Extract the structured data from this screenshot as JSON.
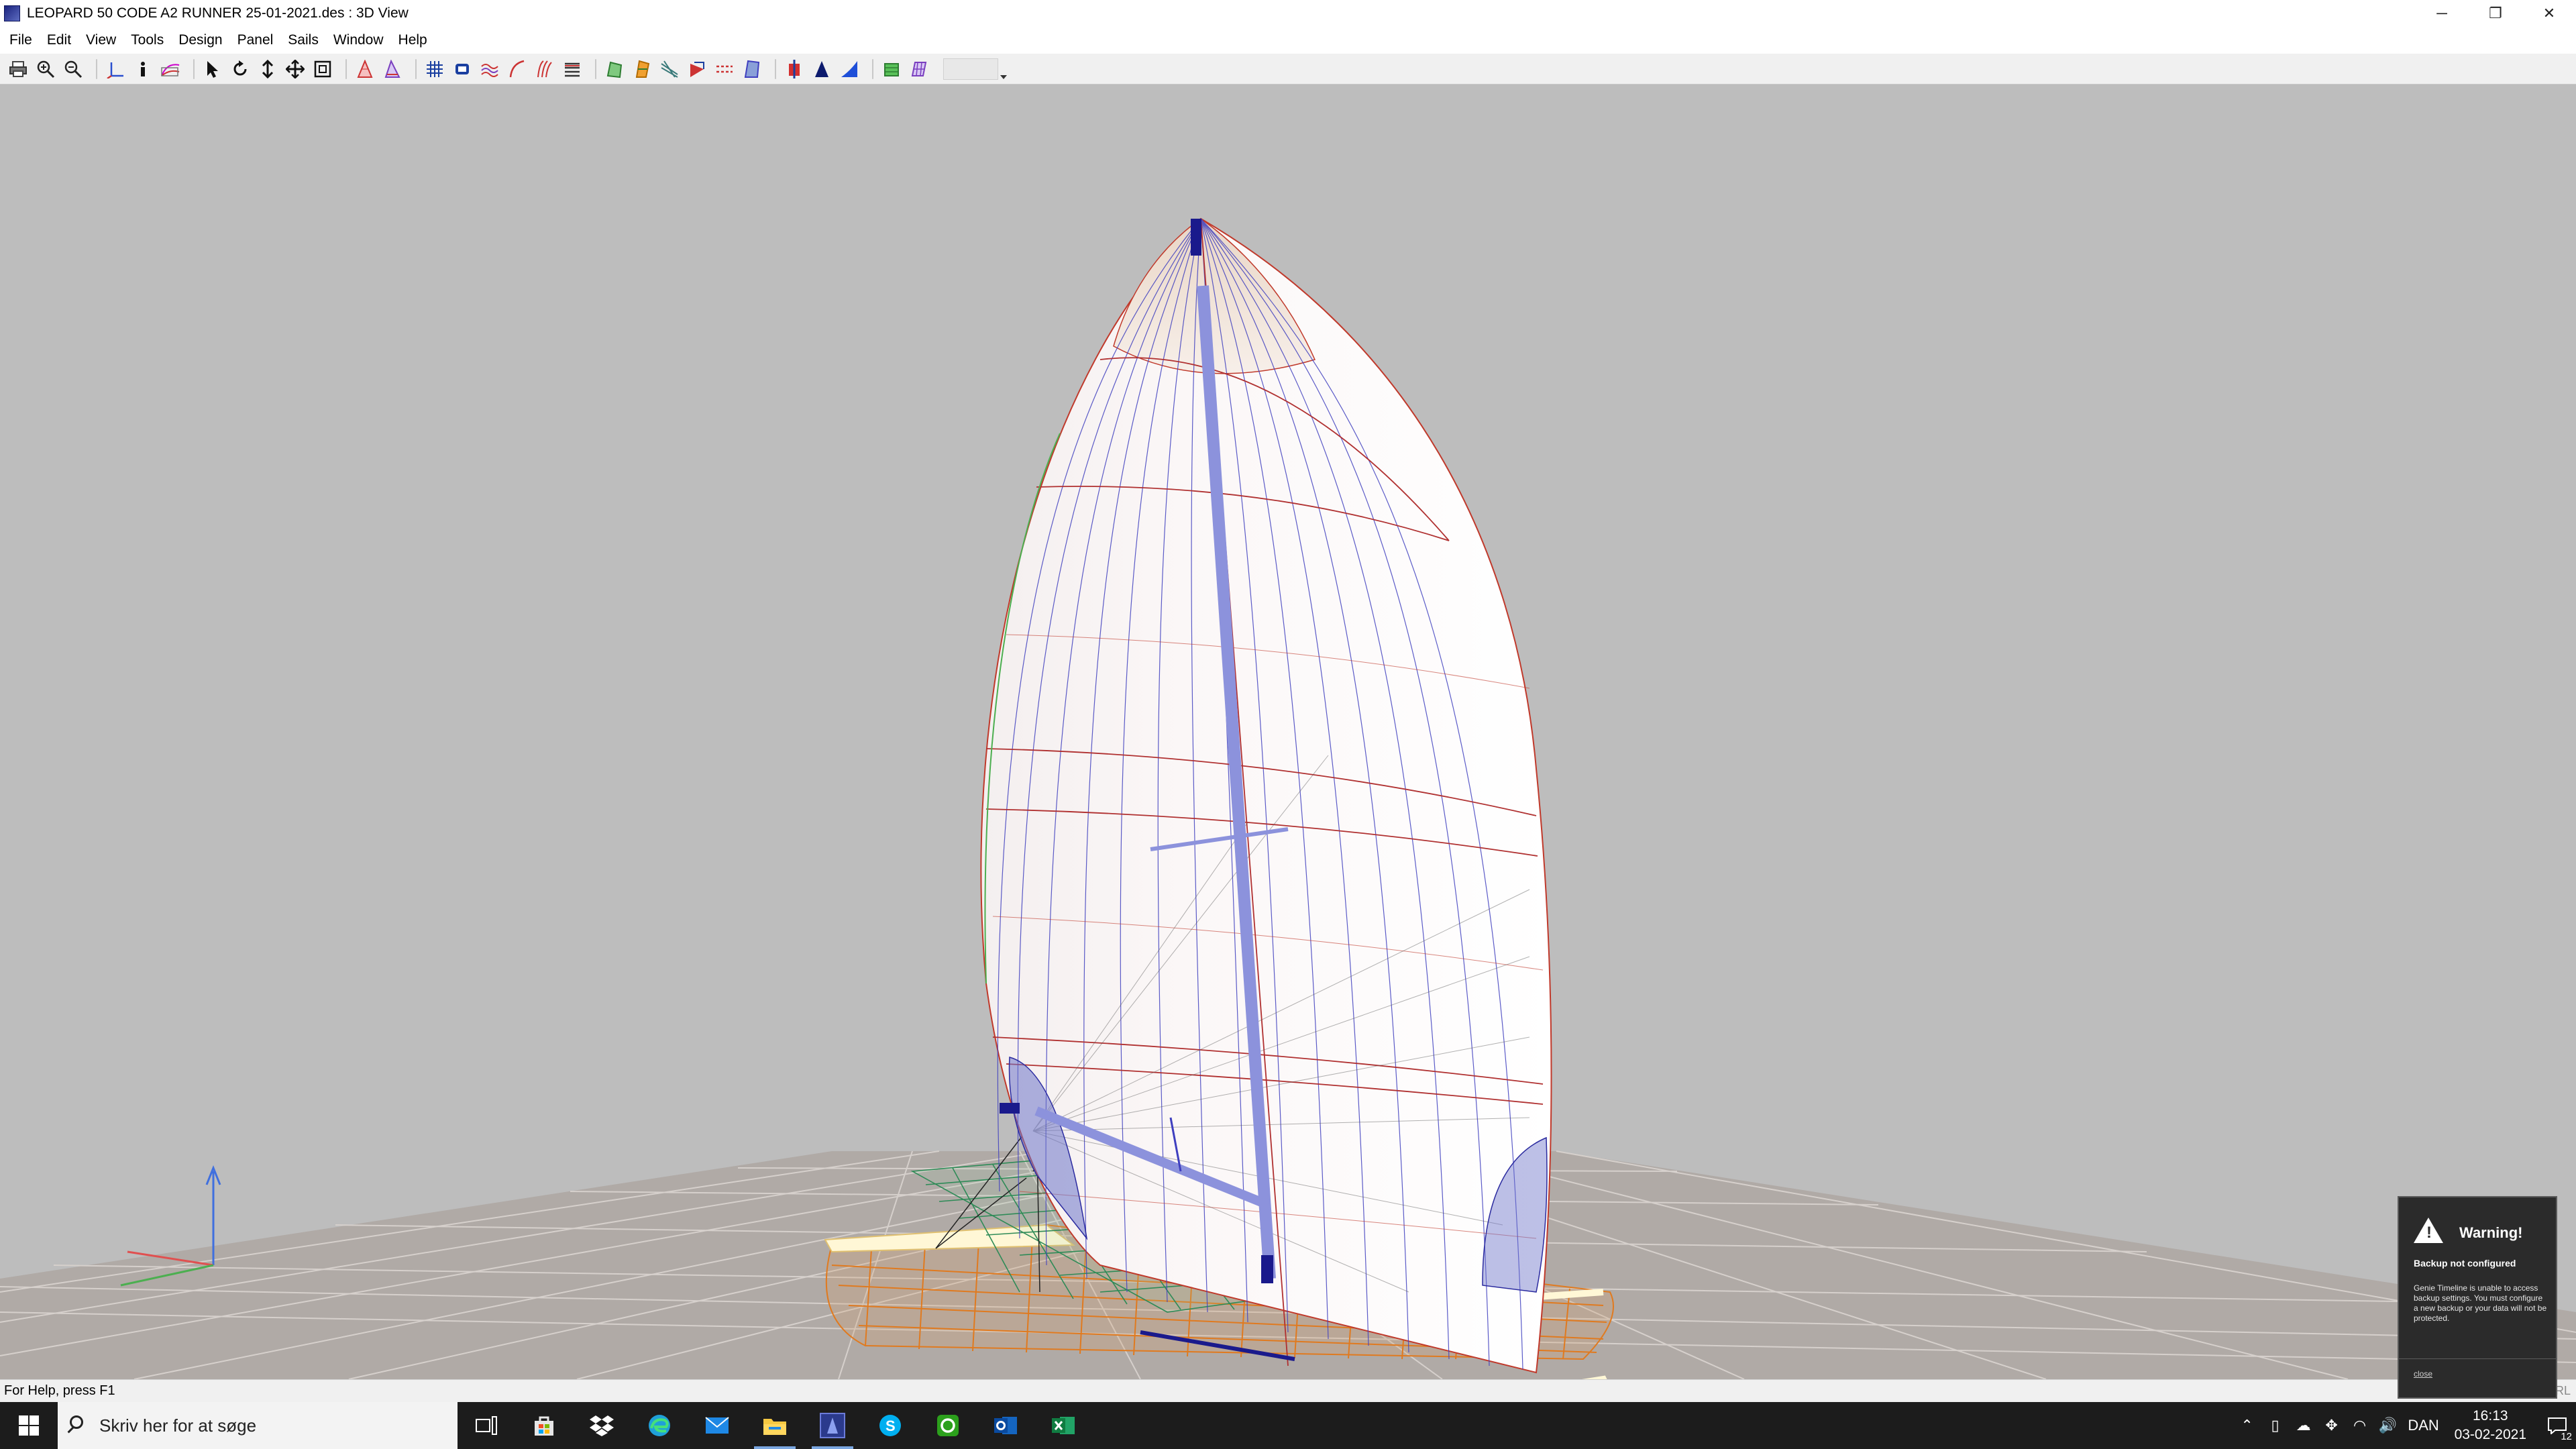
{
  "window": {
    "title": "LEOPARD 50 CODE A2 RUNNER 25-01-2021.des : 3D View",
    "controls": {
      "minimize": "─",
      "restore": "❐",
      "close": "✕"
    }
  },
  "menu": {
    "items": [
      "File",
      "Edit",
      "View",
      "Tools",
      "Design",
      "Panel",
      "Sails",
      "Window",
      "Help"
    ]
  },
  "toolbar": {
    "icons": [
      "print-icon",
      "zoom-in-icon",
      "zoom-out-icon",
      "axes-icon",
      "info-icon",
      "curve-view-icon",
      "select-arrow-icon",
      "rotate-icon",
      "pan-vertical-icon",
      "move-icon",
      "fit-view-icon",
      "sail-red-icon",
      "sail-purple-icon",
      "grid-icon",
      "box-icon",
      "waves-icon",
      "curve-icon",
      "seams-icon",
      "panels-icon",
      "green-sail-icon",
      "orange-sail-icon",
      "broadseam-icon",
      "spreader-icon",
      "dashed-lines-icon",
      "shade-icon",
      "red-sail-icon",
      "blue-hull-icon",
      "blue-sail-icon",
      "green-panel-icon",
      "mesh-icon"
    ]
  },
  "status": {
    "help": "For Help, press F1",
    "right": "CRL"
  },
  "taskbar": {
    "search_placeholder": "Skriv her for at søge",
    "apps": [
      "task-view-icon",
      "store-icon",
      "dropbox-icon",
      "edge-icon",
      "mail-icon",
      "file-explorer-icon",
      "sail-app-icon",
      "skype-icon",
      "quickbooks-icon",
      "outlook-icon",
      "excel-icon"
    ],
    "language": "DAN",
    "time": "16:13",
    "date": "03-02-2021",
    "notifications": "12"
  },
  "toast": {
    "title": "Warning!",
    "subtitle": "Backup not configured",
    "body": "Genie Timeline is unable to access backup settings. You must configure a new backup or your data will not be protected.",
    "action": "close"
  },
  "colors": {
    "viewport_bg": "#bdbdbd",
    "sail_outline": "#c0392b",
    "sail_mesh": "#3f3fbf",
    "hull": "#e07a1f",
    "deck_mesh": "#2e8b57",
    "mast": "#1a1a8c"
  }
}
